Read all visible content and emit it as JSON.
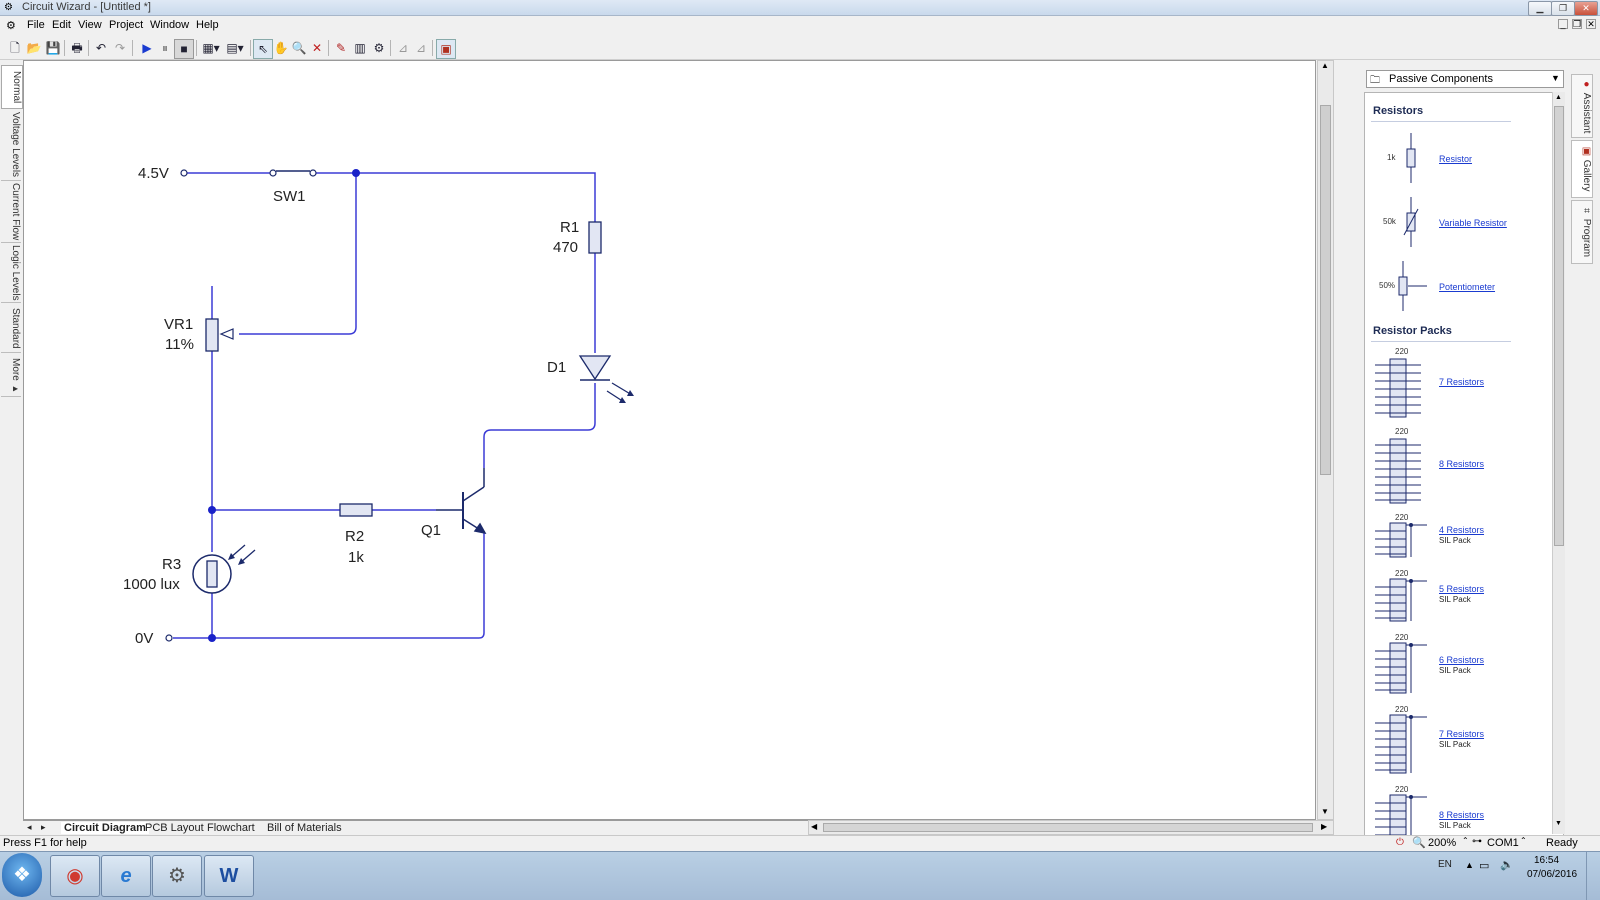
{
  "window": {
    "title": "Circuit Wizard - [Untitled *]"
  },
  "menu": [
    "File",
    "Edit",
    "View",
    "Project",
    "Window",
    "Help"
  ],
  "left_tabs": [
    "Normal",
    "Voltage Levels",
    "Current Flow",
    "Logic Levels",
    "Standard",
    "More ▸"
  ],
  "circuit": {
    "labels": {
      "v45": "4.5V",
      "v0": "0V",
      "sw1": "SW1",
      "r1": "R1",
      "r1_val": "470",
      "vr1": "VR1",
      "vr1_val": "11%",
      "d1": "D1",
      "r2": "R2",
      "r2_val": "1k",
      "q1": "Q1",
      "r3": "R3",
      "r3_val": "1000 lux"
    }
  },
  "bottom_tabs": [
    "Circuit Diagram",
    "PCB Layout",
    "Flowchart",
    "Bill of Materials"
  ],
  "panel": {
    "dropdown": "Passive Components",
    "section_resistors": "Resistors",
    "resistors": [
      {
        "label": "Resistor",
        "value": "1k"
      },
      {
        "label": "Variable Resistor",
        "value": "50k"
      },
      {
        "label": "Potentiometer",
        "value": "50%"
      }
    ],
    "section_packs": "Resistor Packs",
    "packs": [
      {
        "label": "7 Resistors",
        "sub": "",
        "value": "220"
      },
      {
        "label": "8 Resistors",
        "sub": "",
        "value": "220"
      },
      {
        "label": "4 Resistors",
        "sub": "SIL Pack",
        "value": "220"
      },
      {
        "label": "5 Resistors",
        "sub": "SIL Pack",
        "value": "220"
      },
      {
        "label": "6 Resistors",
        "sub": "SIL Pack",
        "value": "220"
      },
      {
        "label": "7 Resistors",
        "sub": "SIL Pack",
        "value": "220"
      },
      {
        "label": "8 Resistors",
        "sub": "SIL Pack",
        "value": "220"
      }
    ]
  },
  "right_tabs": [
    "Assistant",
    "Gallery",
    "Program"
  ],
  "status": {
    "help": "Press F1 for help",
    "zoom": "200%",
    "port": "COM1",
    "state": "Ready"
  },
  "taskbar": {
    "lang": "EN",
    "time": "16:54",
    "date": "07/06/2016"
  },
  "colors": {
    "wire": "#3b3bd6",
    "component": "#1c2a6b",
    "fill": "#e2e6f3"
  }
}
